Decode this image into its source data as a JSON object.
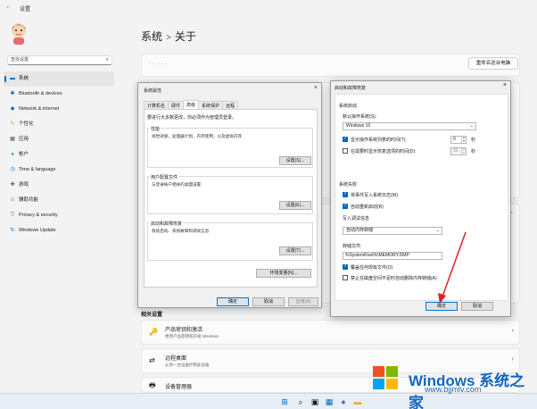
{
  "settings": {
    "app_title": "设置",
    "back": "←",
    "search_placeholder": "查找设置",
    "nav": [
      {
        "label": "系统",
        "icon": "▬"
      },
      {
        "label": "Bluetooth & devices",
        "icon": "✱"
      },
      {
        "label": "Network & internet",
        "icon": "◆"
      },
      {
        "label": "个性化",
        "icon": "✎"
      },
      {
        "label": "应用",
        "icon": "▦"
      },
      {
        "label": "帐户",
        "icon": "●"
      },
      {
        "label": "Time & language",
        "icon": "◷"
      },
      {
        "label": "游戏",
        "icon": "✚"
      },
      {
        "label": "辅助功能",
        "icon": "☺"
      },
      {
        "label": "Privacy & security",
        "icon": "⛉"
      },
      {
        "label": "Windows Update",
        "icon": "↻"
      }
    ],
    "breadcrumb": {
      "parent": "系统",
      "sep": ">",
      "current": "关于"
    },
    "device_name_dots": "· · · · · ·",
    "rename_label": "重命名这台电脑",
    "related_title": "相关设置",
    "related": [
      {
        "title": "产品密钥和激活",
        "subtitle": "更改产品密钥或升级 Windows",
        "icon": "🔑"
      },
      {
        "title": "远程桌面",
        "subtitle": "从另一台设备控制此设备",
        "icon": "⇄"
      },
      {
        "title": "设备管理器",
        "subtitle": "",
        "icon": "🖶"
      }
    ]
  },
  "sysprop": {
    "title": "系统属性",
    "tabs": [
      "计算机名",
      "硬件",
      "高级",
      "系统保护",
      "远程"
    ],
    "note": "要进行大多数更改，你必须作为管理员登录。",
    "groups": [
      {
        "title": "性能",
        "desc": "视觉效果，处理器计划，内存使用，以及虚拟内存",
        "btn": "设置(S)..."
      },
      {
        "title": "用户配置文件",
        "desc": "与登录帐户相关的桌面设置",
        "btn": "设置(E)..."
      },
      {
        "title": "启动和故障恢复",
        "desc": "系统启动、系统故障和调试信息",
        "btn": "设置(T)..."
      }
    ],
    "env_btn": "环境变量(N)...",
    "ok": "确定",
    "cancel": "取消",
    "apply": "应用(A)"
  },
  "startup": {
    "title": "启动和故障恢复",
    "sys_start_label": "系统启动",
    "default_os_label": "默认操作系统(S):",
    "default_os_value": "Windows 10",
    "show_list_label": "显示操作系统列表的时间(T):",
    "show_list_value": "0",
    "show_recovery_label": "在需要时显示恢复选项的时间(D):",
    "show_recovery_value": "30",
    "sec": "秒",
    "failure_label": "系统失败",
    "write_event_label": "将事件写入系统日志(W)",
    "auto_restart_label": "自动重新启动(R)",
    "debug_label": "写入调试信息",
    "debug_value": "自动内存转储",
    "dump_file_label": "转储文件:",
    "dump_file_value": "%SystemRoot%\\MEMORY.DMP",
    "overwrite_label": "覆盖任何现有文件(O)",
    "disable_autodelete_label": "禁止在磁盘空间不足时自动删除内存转储(A)",
    "ok": "确定",
    "cancel": "取消"
  },
  "watermark": {
    "brand": "Windows 系统之家",
    "url": "www.bjjmlv.com"
  }
}
